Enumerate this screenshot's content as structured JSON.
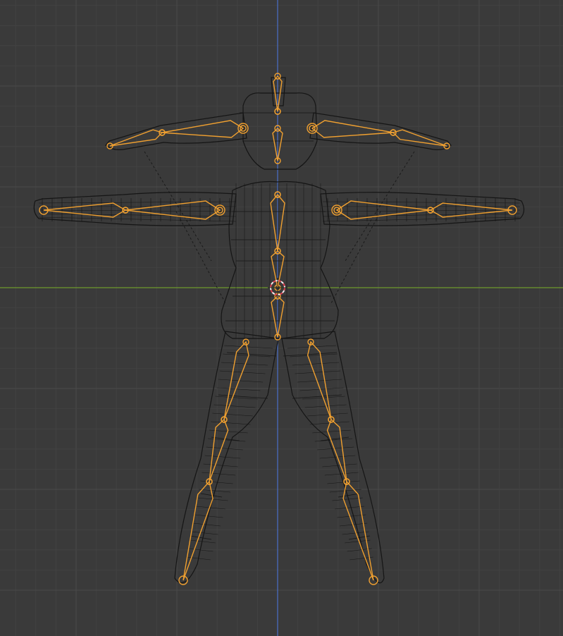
{
  "viewport": {
    "view": "front-orthographic",
    "shading": "wireframe",
    "colors": {
      "background": "#3a3a3a",
      "grid_minor": "#424242",
      "grid_major": "#4a4a4a",
      "x_axis": "#6e9a2c",
      "z_axis": "#4a70c8",
      "bone": "#f0a030",
      "mesh_wire": "#151515",
      "relationship_line": "#1a1a1a",
      "cursor_red": "#e04050",
      "cursor_white": "#f0f0f0"
    }
  },
  "armature": {
    "bones": [
      "head",
      "neck",
      "spine-upper",
      "spine-mid",
      "spine-lower",
      "hips",
      "clavicle-l",
      "upper-arm-l",
      "clavicle-r",
      "upper-arm-r",
      "forearm-l",
      "hand-l",
      "forearm-r",
      "hand-r",
      "thigh-l",
      "shin-l",
      "foot-l",
      "thigh-r",
      "shin-r",
      "foot-r"
    ]
  },
  "cursor": {
    "name": "3d-cursor"
  }
}
